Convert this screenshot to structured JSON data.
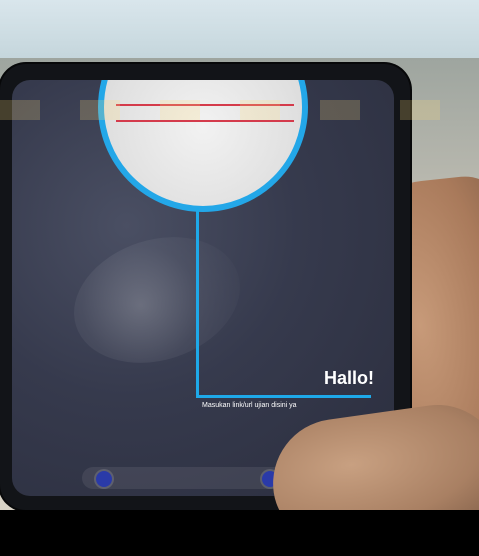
{
  "screen": {
    "greeting": "Hallo!",
    "message": "Masukan link/url ujian disini ya"
  }
}
